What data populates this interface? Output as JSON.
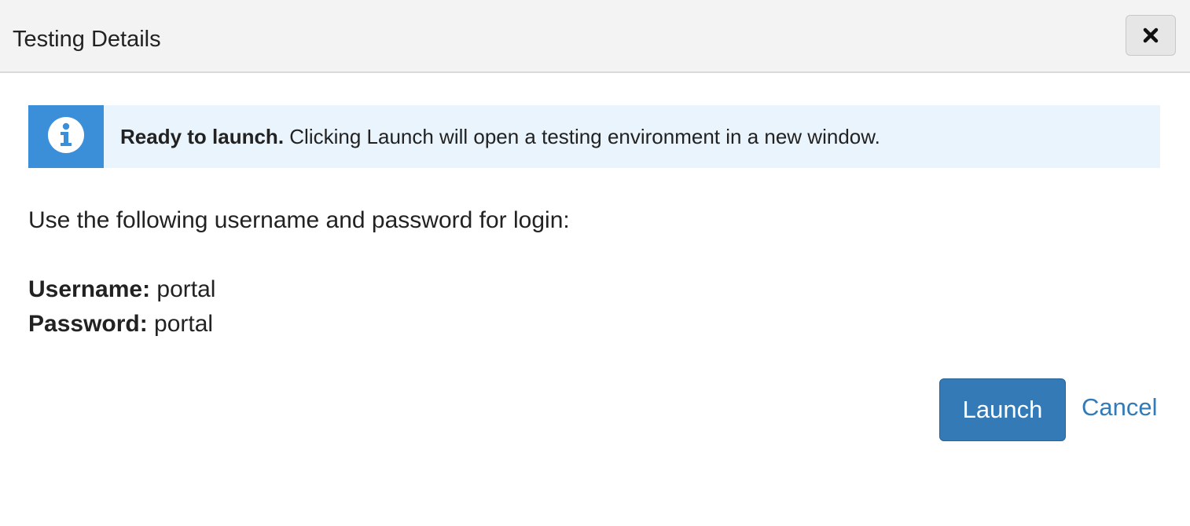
{
  "dialog": {
    "title": "Testing Details",
    "close_icon": "close-icon"
  },
  "alert": {
    "icon": "info-icon",
    "strong_text": "Ready to launch.",
    "text": " Clicking Launch will open a testing environment in a new window.",
    "accent_color": "#3b8fd9",
    "background_color": "#eaf4fc"
  },
  "instructions": "Use the following username and password for login:",
  "credentials": {
    "username_label": "Username:",
    "username_value": " portal",
    "password_label": "Password:",
    "password_value": " portal"
  },
  "footer": {
    "launch_label": "Launch",
    "cancel_label": "Cancel",
    "primary_color": "#337ab7"
  }
}
